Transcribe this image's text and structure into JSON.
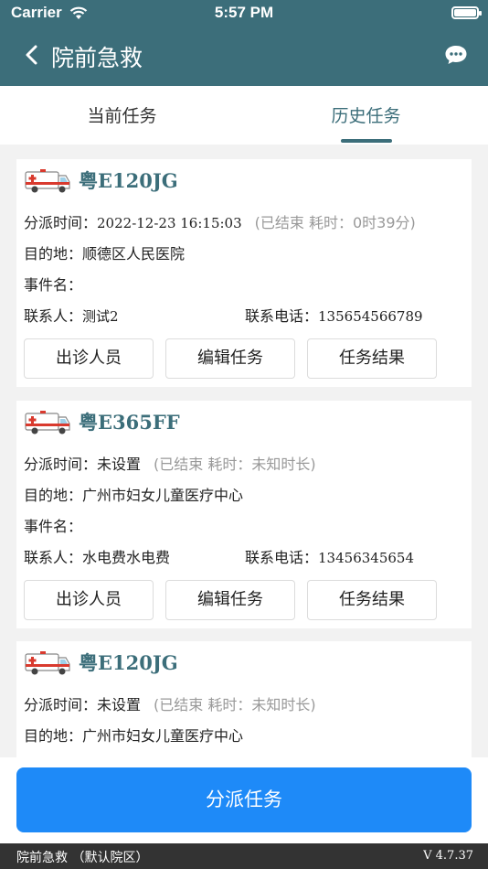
{
  "status": {
    "carrier": "Carrier",
    "time": "5:57 PM"
  },
  "nav": {
    "title": "院前急救"
  },
  "tabs": [
    {
      "label": "当前任务",
      "active": false
    },
    {
      "label": "历史任务",
      "active": true
    }
  ],
  "labels": {
    "dispatch_time": "分派时间：",
    "destination": "目的地：",
    "event_name": "事件名：",
    "contact": "联系人：",
    "phone": "联系电话："
  },
  "tasks": [
    {
      "plate": "粤E120JG",
      "dispatch_time": "2022-12-23 16:15:03",
      "status_note": "(已结束 耗时：0时39分)",
      "destination": "顺德区人民医院",
      "event_name": "",
      "contact": "测试2",
      "phone": "135654566789"
    },
    {
      "plate": "粤E365FF",
      "dispatch_time": "未设置",
      "status_note": "(已结束 耗时：未知时长)",
      "destination": "广州市妇女儿童医疗中心",
      "event_name": "",
      "contact": "水电费水电费",
      "phone": "13456345654"
    },
    {
      "plate": "粤E120JG",
      "dispatch_time": "未设置",
      "status_note": "(已结束 耗时：未知时长)",
      "destination": "广州市妇女儿童医疗中心",
      "event_name": "",
      "contact": "",
      "phone": ""
    }
  ],
  "card_buttons": {
    "staff": "出诊人员",
    "edit": "编辑任务",
    "result": "任务结果"
  },
  "dispatch_button": "分派任务",
  "bottom_bar": {
    "left": "院前急救 （默认院区）",
    "version": "V 4.7.37"
  },
  "colors": {
    "header": "#3c6e7a",
    "accent": "#1e8af8",
    "plate": "#3c6e7a"
  }
}
